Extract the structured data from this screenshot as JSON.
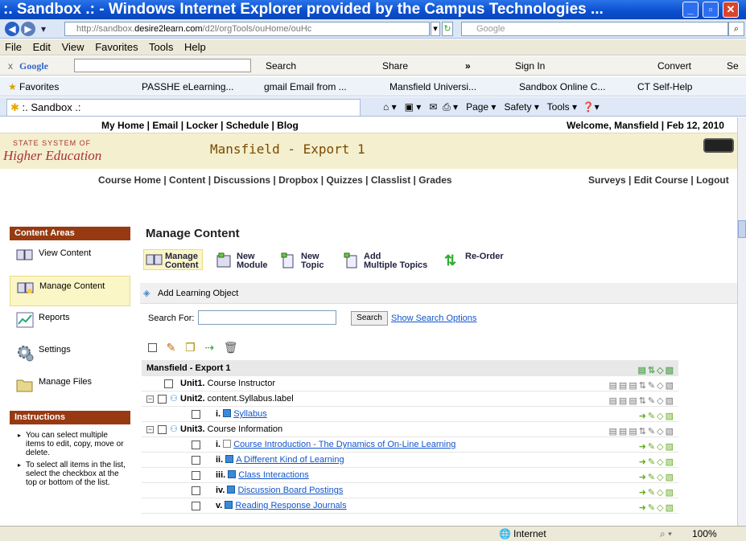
{
  "window": {
    "title": ":. Sandbox .: - Windows Internet Explorer provided by the Campus Technologies ...",
    "controls": {
      "minimize": "_",
      "maximize": "▫",
      "close": "✕"
    }
  },
  "address": {
    "url_prefix": "http://sandbox.",
    "url_domain": "desire2learn.com",
    "url_rest": "/d2l/orgTools/ouHome/ouHc",
    "search_placeholder": "Google"
  },
  "menu": [
    "File",
    "Edit",
    "View",
    "Favorites",
    "Tools",
    "Help"
  ],
  "google_bar": {
    "close": "x",
    "brand": "Google",
    "search": "Search",
    "share": "Share",
    "more": "»",
    "sign_in": "Sign In",
    "convert": "Convert",
    "select": "Se"
  },
  "favorites": {
    "label": "Favorites",
    "items": [
      "PASSHE eLearning...",
      "gmail Email from ...",
      "Mansfield Universi...",
      "Sandbox Online C...",
      "CT Self-Help"
    ]
  },
  "tab": {
    "label": ":. Sandbox .:"
  },
  "command_bar": {
    "page": "Page",
    "safety": "Safety",
    "tools": "Tools"
  },
  "top_links": {
    "nav": "My Home | Email | Locker | Schedule | Blog",
    "welcome": "Welcome, Mansfield | Feb 12, 2010"
  },
  "logo": {
    "line1": "STATE SYSTEM OF",
    "line2": "Higher Education"
  },
  "course": {
    "name": "Mansfield - Export 1"
  },
  "course_nav": {
    "left": "Course Home | Content | Discussions | Dropbox | Quizzes | Classlist | Grades",
    "right": "Surveys | Edit Course | Logout"
  },
  "sidebar": {
    "heading": "Content Areas",
    "items": [
      "View Content",
      "Manage Content",
      "Reports",
      "Settings",
      "Manage Files"
    ],
    "instructions_heading": "Instructions",
    "instructions": [
      "You can select multiple items to edit, copy, move or delete.",
      "To select all items in the list, select the checkbox at the top or bottom of the list."
    ]
  },
  "main": {
    "title": "Manage Content",
    "actions": [
      {
        "l1": "Manage",
        "l2": "Content"
      },
      {
        "l1": "New",
        "l2": "Module"
      },
      {
        "l1": "New",
        "l2": "Topic"
      },
      {
        "l1": "Add",
        "l2": "Multiple Topics"
      },
      {
        "l1": "Re-Order",
        "l2": ""
      }
    ],
    "add_learning_object": "Add Learning Object",
    "search_label": "Search For:",
    "search_button": "Search",
    "search_options": "Show Search Options",
    "tree_header": "Mansfield - Export 1",
    "rows": [
      {
        "num": "Unit1.",
        "text": "Course Instructor"
      },
      {
        "num": "Unit2.",
        "text": "content.Syllabus.label"
      },
      {
        "num": "i.",
        "text": "Syllabus"
      },
      {
        "num": "Unit3.",
        "text": "Course Information"
      },
      {
        "num": "i.",
        "text": "Course Introduction - The Dynamics of On-Line Learning"
      },
      {
        "num": "ii.",
        "text": "A Different Kind of Learning"
      },
      {
        "num": "iii.",
        "text": "Class Interactions"
      },
      {
        "num": "iv.",
        "text": "Discussion Board Postings"
      },
      {
        "num": "v.",
        "text": "Reading Response Journals"
      }
    ]
  },
  "status": {
    "zone": "Internet",
    "zoom": "100%"
  }
}
